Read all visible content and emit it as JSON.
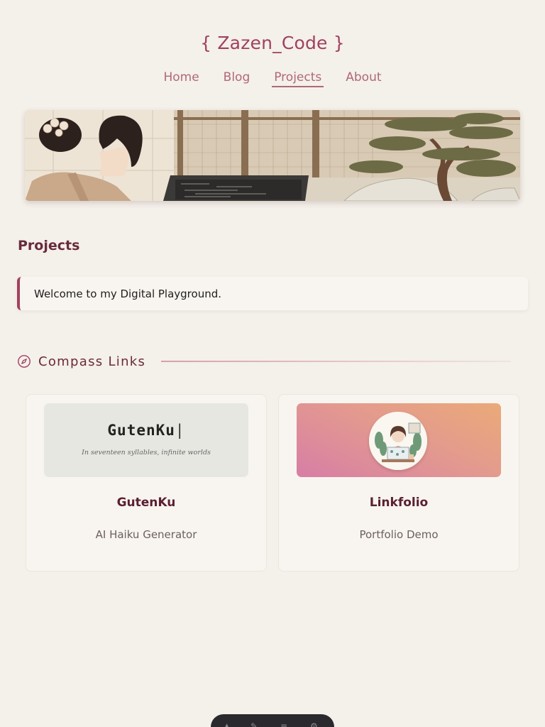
{
  "site": {
    "title": "{ Zazen_Code }"
  },
  "nav": {
    "items": [
      {
        "label": "Home",
        "active": false
      },
      {
        "label": "Blog",
        "active": false
      },
      {
        "label": "Projects",
        "active": true
      },
      {
        "label": "About",
        "active": false
      }
    ]
  },
  "banner": {
    "icon": "zen-coder-banner-illustration"
  },
  "page": {
    "heading": "Projects"
  },
  "welcome": {
    "text": "Welcome to my Digital Playground."
  },
  "section": {
    "icon": "compass-icon",
    "title": "Compass Links"
  },
  "projects": [
    {
      "name": "GutenKu",
      "description": "AI Haiku Generator",
      "thumb": {
        "title": "GutenKu",
        "cursor": "|",
        "subtitle": "In seventeen syllables, infinite worlds"
      }
    },
    {
      "name": "Linkfolio",
      "description": "Portfolio Demo",
      "thumb": {
        "icon": "avatar-illustration"
      }
    }
  ],
  "colors": {
    "accent": "#a0415e",
    "background": "#f4f0ea",
    "nav": "#b06878"
  }
}
